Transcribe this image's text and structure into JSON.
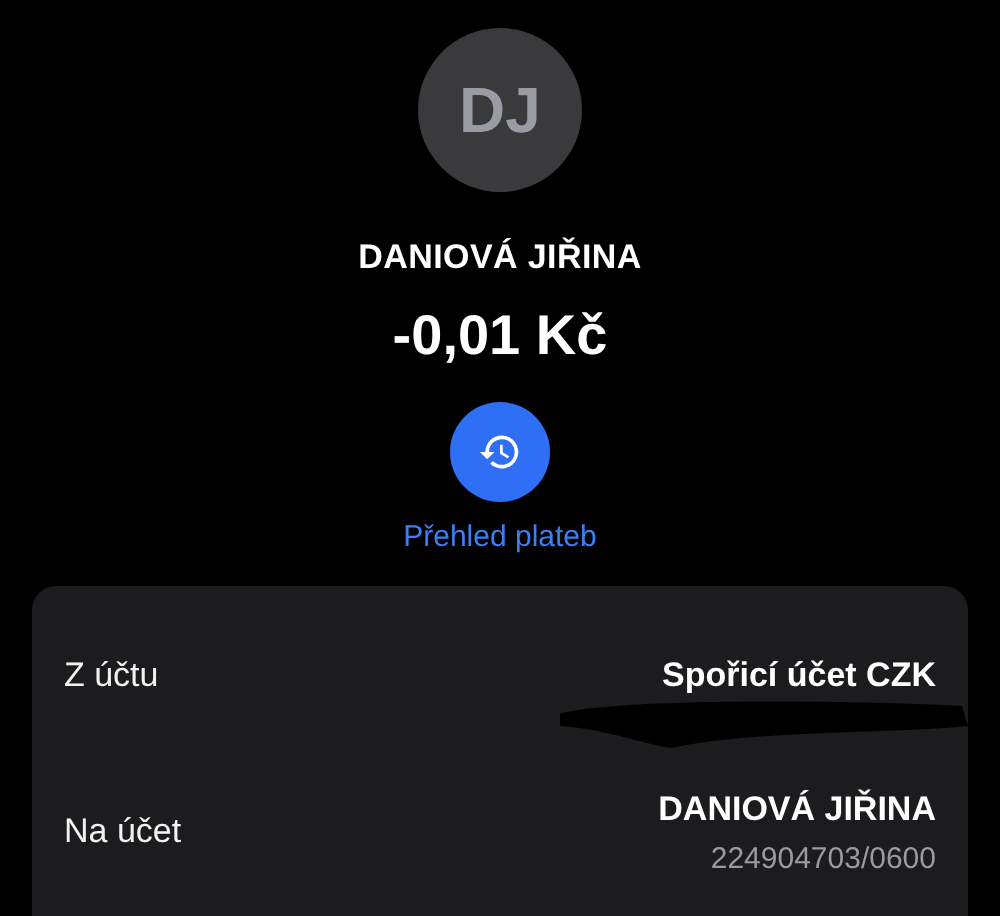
{
  "contact": {
    "initials": "DJ",
    "name": "DANIOVÁ JIŘINA",
    "amount": "-0,01 Kč"
  },
  "history_link": {
    "label": "Přehled plateb"
  },
  "details": [
    {
      "label": "Z účtu",
      "value": "Spořicí účet CZK",
      "redacted": true
    },
    {
      "label": "Na účet",
      "value": "DANIOVÁ JIŘINA",
      "sub": "224904703/0600",
      "redacted": false
    }
  ]
}
